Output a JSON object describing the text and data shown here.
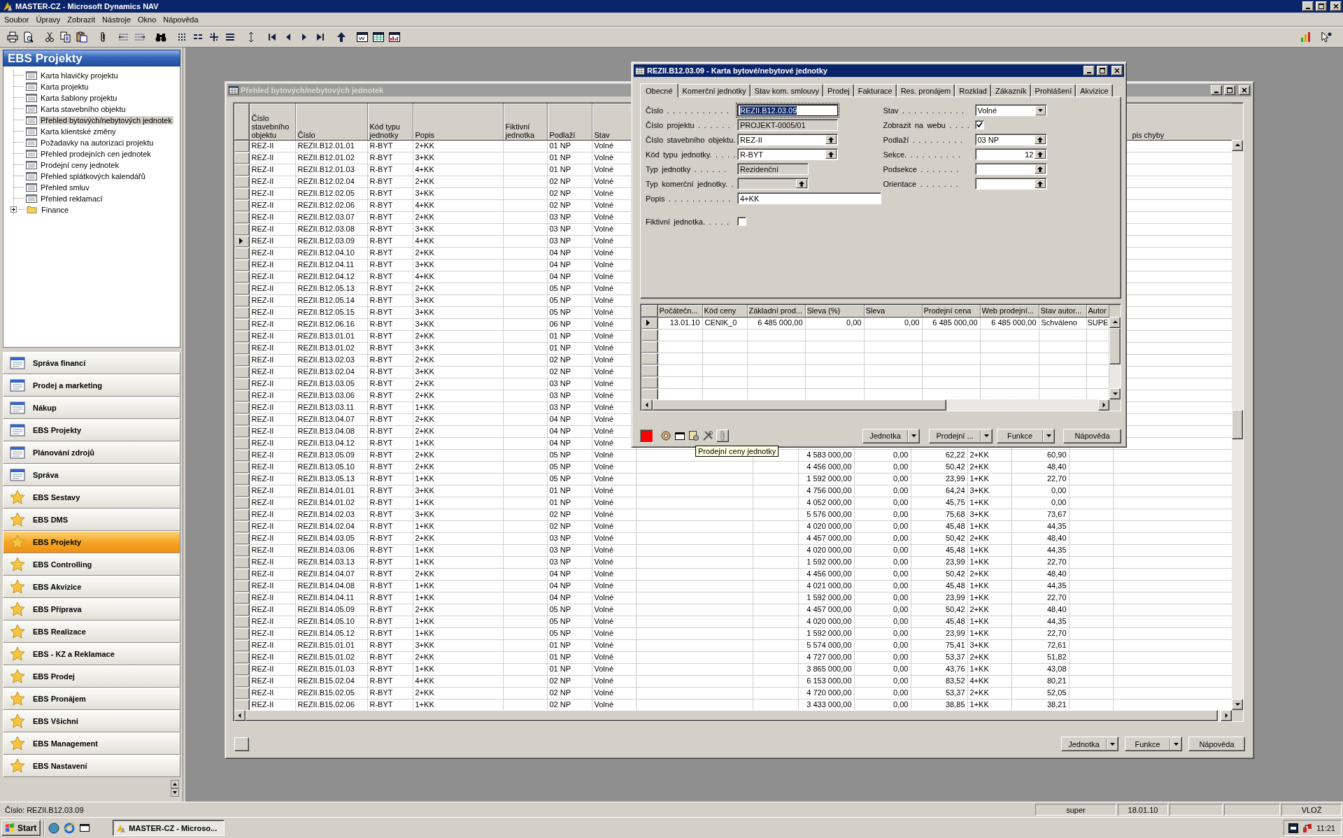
{
  "window": {
    "title": "MASTER-CZ - Microsoft Dynamics NAV"
  },
  "menu": [
    "Soubor",
    "Úpravy",
    "Zobrazit",
    "Nástroje",
    "Okno",
    "Nápověda"
  ],
  "sidebar": {
    "title": "EBS Projekty",
    "items": [
      {
        "label": "Karta hlavičky projektu",
        "kind": "page",
        "selected": false
      },
      {
        "label": "Karta projektu",
        "kind": "page",
        "selected": false
      },
      {
        "label": "Karta šablony projektu",
        "kind": "page",
        "selected": false
      },
      {
        "label": "Karta stavebního objektu",
        "kind": "page",
        "selected": false
      },
      {
        "label": "Přehled bytových/nebytových jednotek",
        "kind": "page",
        "selected": true
      },
      {
        "label": "Karta klientské změny",
        "kind": "page",
        "selected": false
      },
      {
        "label": "Požadavky na autorizaci projektu",
        "kind": "page",
        "selected": false
      },
      {
        "label": "Přehled prodejních cen jednotek",
        "kind": "page",
        "selected": false
      },
      {
        "label": "Prodejní ceny jednotek",
        "kind": "page",
        "selected": false
      },
      {
        "label": "Přehled splátkových kalendářů",
        "kind": "page",
        "selected": false
      },
      {
        "label": "Přehled smluv",
        "kind": "page",
        "selected": false
      },
      {
        "label": "Přehled reklamací",
        "kind": "page",
        "selected": false
      },
      {
        "label": "Finance",
        "kind": "folder",
        "selected": false,
        "expanded": false
      }
    ],
    "modules": [
      {
        "label": "Správa financí",
        "kind": "app",
        "selected": false
      },
      {
        "label": "Prodej a marketing",
        "kind": "app",
        "selected": false
      },
      {
        "label": "Nákup",
        "kind": "app",
        "selected": false
      },
      {
        "label": "EBS Projekty",
        "kind": "app",
        "selected": false
      },
      {
        "label": "Plánování zdrojů",
        "kind": "app",
        "selected": false
      },
      {
        "label": "Správa",
        "kind": "app",
        "selected": false
      },
      {
        "label": "EBS Sestavy",
        "kind": "star",
        "selected": false
      },
      {
        "label": "EBS DMS",
        "kind": "star",
        "selected": false
      },
      {
        "label": "EBS Projekty",
        "kind": "star",
        "selected": true
      },
      {
        "label": "EBS Controlling",
        "kind": "star",
        "selected": false
      },
      {
        "label": "EBS Akvizice",
        "kind": "star",
        "selected": false
      },
      {
        "label": "EBS Příprava",
        "kind": "star",
        "selected": false
      },
      {
        "label": "EBS Realizace",
        "kind": "star",
        "selected": false
      },
      {
        "label": "EBS - KZ a Reklamace",
        "kind": "star",
        "selected": false
      },
      {
        "label": "EBS Prodej",
        "kind": "star",
        "selected": false
      },
      {
        "label": "EBS Pronájem",
        "kind": "star",
        "selected": false
      },
      {
        "label": "EBS Všichni",
        "kind": "star",
        "selected": false
      },
      {
        "label": "EBS Management",
        "kind": "star",
        "selected": false
      },
      {
        "label": "EBS Nastavení",
        "kind": "star",
        "selected": false
      }
    ]
  },
  "list_window": {
    "title": "Přehled bytových/nebytových jednotek",
    "active": false,
    "columns": [
      "Číslo stavebního objektu",
      "Číslo",
      "Kód typu jednotky",
      "Popis",
      "Fiktivní jednotka",
      "Podlaží",
      "Stav",
      "pis chyby"
    ],
    "rows": [
      {
        "objekt": "REZ-II",
        "cislo": "REZII.B12.01.01",
        "typ": "R-BYT",
        "popis": "2+KK",
        "podlazi": "01 NP",
        "stav": "Volné",
        "selected": false
      },
      {
        "objekt": "REZ-II",
        "cislo": "REZII.B12.01.02",
        "typ": "R-BYT",
        "popis": "3+KK",
        "podlazi": "01 NP",
        "stav": "Volné",
        "selected": false
      },
      {
        "objekt": "REZ-II",
        "cislo": "REZII.B12.01.03",
        "typ": "R-BYT",
        "popis": "4+KK",
        "podlazi": "01 NP",
        "stav": "Volné",
        "selected": false
      },
      {
        "objekt": "REZ-II",
        "cislo": "REZII.B12.02.04",
        "typ": "R-BYT",
        "popis": "2+KK",
        "podlazi": "02 NP",
        "stav": "Volné",
        "selected": false
      },
      {
        "objekt": "REZ-II",
        "cislo": "REZII.B12.02.05",
        "typ": "R-BYT",
        "popis": "3+KK",
        "podlazi": "02 NP",
        "stav": "Volné",
        "selected": false
      },
      {
        "objekt": "REZ-II",
        "cislo": "REZII.B12.02.06",
        "typ": "R-BYT",
        "popis": "4+KK",
        "podlazi": "02 NP",
        "stav": "Volné",
        "selected": false
      },
      {
        "objekt": "REZ-II",
        "cislo": "REZII.B12.03.07",
        "typ": "R-BYT",
        "popis": "2+KK",
        "podlazi": "03 NP",
        "stav": "Volné",
        "selected": false
      },
      {
        "objekt": "REZ-II",
        "cislo": "REZII.B12.03.08",
        "typ": "R-BYT",
        "popis": "3+KK",
        "podlazi": "03 NP",
        "stav": "Volné",
        "selected": false
      },
      {
        "objekt": "REZ-II",
        "cislo": "REZII.B12.03.09",
        "typ": "R-BYT",
        "popis": "4+KK",
        "podlazi": "03 NP",
        "stav": "Volné",
        "selected": true
      },
      {
        "objekt": "REZ-II",
        "cislo": "REZII.B12.04.10",
        "typ": "R-BYT",
        "popis": "2+KK",
        "podlazi": "04 NP",
        "stav": "Volné",
        "selected": false
      },
      {
        "objekt": "REZ-II",
        "cislo": "REZII.B12.04.11",
        "typ": "R-BYT",
        "popis": "3+KK",
        "podlazi": "04 NP",
        "stav": "Volné",
        "selected": false
      },
      {
        "objekt": "REZ-II",
        "cislo": "REZII.B12.04.12",
        "typ": "R-BYT",
        "popis": "4+KK",
        "podlazi": "04 NP",
        "stav": "Volné",
        "selected": false
      },
      {
        "objekt": "REZ-II",
        "cislo": "REZII.B12.05.13",
        "typ": "R-BYT",
        "popis": "2+KK",
        "podlazi": "05 NP",
        "stav": "Volné",
        "selected": false
      },
      {
        "objekt": "REZ-II",
        "cislo": "REZII.B12.05.14",
        "typ": "R-BYT",
        "popis": "3+KK",
        "podlazi": "05 NP",
        "stav": "Volné",
        "selected": false
      },
      {
        "objekt": "REZ-II",
        "cislo": "REZII.B12.05.15",
        "typ": "R-BYT",
        "popis": "3+KK",
        "podlazi": "05 NP",
        "stav": "Volné",
        "selected": false
      },
      {
        "objekt": "REZ-II",
        "cislo": "REZII.B12.06.16",
        "typ": "R-BYT",
        "popis": "3+KK",
        "podlazi": "06 NP",
        "stav": "Volné",
        "selected": false
      },
      {
        "objekt": "REZ-II",
        "cislo": "REZII.B13.01.01",
        "typ": "R-BYT",
        "popis": "2+KK",
        "podlazi": "01 NP",
        "stav": "Volné",
        "selected": false
      },
      {
        "objekt": "REZ-II",
        "cislo": "REZII.B13.01.02",
        "typ": "R-BYT",
        "popis": "3+KK",
        "podlazi": "01 NP",
        "stav": "Volné",
        "selected": false
      },
      {
        "objekt": "REZ-II",
        "cislo": "REZII.B13.02.03",
        "typ": "R-BYT",
        "popis": "2+KK",
        "podlazi": "02 NP",
        "stav": "Volné",
        "selected": false
      },
      {
        "objekt": "REZ-II",
        "cislo": "REZII.B13.02.04",
        "typ": "R-BYT",
        "popis": "3+KK",
        "podlazi": "02 NP",
        "stav": "Volné",
        "selected": false
      },
      {
        "objekt": "REZ-II",
        "cislo": "REZII.B13.03.05",
        "typ": "R-BYT",
        "popis": "2+KK",
        "podlazi": "03 NP",
        "stav": "Volné",
        "selected": false
      },
      {
        "objekt": "REZ-II",
        "cislo": "REZII.B13.03.06",
        "typ": "R-BYT",
        "popis": "2+KK",
        "podlazi": "03 NP",
        "stav": "Volné",
        "selected": false
      },
      {
        "objekt": "REZ-II",
        "cislo": "REZII.B13.03.11",
        "typ": "R-BYT",
        "popis": "1+KK",
        "podlazi": "03 NP",
        "stav": "Volné",
        "selected": false
      },
      {
        "objekt": "REZ-II",
        "cislo": "REZII.B13.04.07",
        "typ": "R-BYT",
        "popis": "2+KK",
        "podlazi": "04 NP",
        "stav": "Volné",
        "selected": false
      },
      {
        "objekt": "REZ-II",
        "cislo": "REZII.B13.04.08",
        "typ": "R-BYT",
        "popis": "2+KK",
        "podlazi": "04 NP",
        "stav": "Volné",
        "selected": false
      },
      {
        "objekt": "REZ-II",
        "cislo": "REZII.B13.04.12",
        "typ": "R-BYT",
        "popis": "1+KK",
        "podlazi": "04 NP",
        "stav": "Volné",
        "selected": false
      },
      {
        "objekt": "REZ-II",
        "cislo": "REZII.B13.05.09",
        "typ": "R-BYT",
        "popis": "2+KK",
        "podlazi": "05 NP",
        "stav": "Volné",
        "column_10": "4 583 000,00",
        "column_11": "0,00",
        "column_12": "62,22",
        "column_13": "2+KK",
        "column_14": "60,90",
        "selected": false
      },
      {
        "objekt": "REZ-II",
        "cislo": "REZII.B13.05.10",
        "typ": "R-BYT",
        "popis": "2+KK",
        "podlazi": "05 NP",
        "stav": "Volné",
        "column_10": "4 456 000,00",
        "column_11": "0,00",
        "column_12": "50,42",
        "column_13": "2+KK",
        "column_14": "48,40",
        "selected": false
      },
      {
        "objekt": "REZ-II",
        "cislo": "REZII.B13.05.13",
        "typ": "R-BYT",
        "popis": "1+KK",
        "podlazi": "05 NP",
        "stav": "Volné",
        "column_10": "1 592 000,00",
        "column_11": "0,00",
        "column_12": "23,99",
        "column_13": "1+KK",
        "column_14": "22,70",
        "selected": false
      },
      {
        "objekt": "REZ-II",
        "cislo": "REZII.B14.01.01",
        "typ": "R-BYT",
        "popis": "3+KK",
        "podlazi": "01 NP",
        "stav": "Volné",
        "column_10": "4 756 000,00",
        "column_11": "0,00",
        "column_12": "64,24",
        "column_13": "3+KK",
        "column_14": "0,00",
        "selected": false
      },
      {
        "objekt": "REZ-II",
        "cislo": "REZII.B14.01.02",
        "typ": "R-BYT",
        "popis": "1+KK",
        "podlazi": "01 NP",
        "stav": "Volné",
        "column_10": "4 052 000,00",
        "column_11": "0,00",
        "column_12": "45,75",
        "column_13": "1+KK",
        "column_14": "0,00",
        "selected": false
      },
      {
        "objekt": "REZ-II",
        "cislo": "REZII.B14.02.03",
        "typ": "R-BYT",
        "popis": "3+KK",
        "podlazi": "02 NP",
        "stav": "Volné",
        "column_10": "5 576 000,00",
        "column_11": "0,00",
        "column_12": "75,68",
        "column_13": "3+KK",
        "column_14": "73,67",
        "selected": false
      },
      {
        "objekt": "REZ-II",
        "cislo": "REZII.B14.02.04",
        "typ": "R-BYT",
        "popis": "1+KK",
        "podlazi": "02 NP",
        "stav": "Volné",
        "column_10": "4 020 000,00",
        "column_11": "0,00",
        "column_12": "45,48",
        "column_13": "1+KK",
        "column_14": "44,35",
        "selected": false
      },
      {
        "objekt": "REZ-II",
        "cislo": "REZII.B14.03.05",
        "typ": "R-BYT",
        "popis": "2+KK",
        "podlazi": "03 NP",
        "stav": "Volné",
        "column_10": "4 457 000,00",
        "column_11": "0,00",
        "column_12": "50,42",
        "column_13": "2+KK",
        "column_14": "48,40",
        "selected": false
      },
      {
        "objekt": "REZ-II",
        "cislo": "REZII.B14.03.06",
        "typ": "R-BYT",
        "popis": "1+KK",
        "podlazi": "03 NP",
        "stav": "Volné",
        "column_10": "4 020 000,00",
        "column_11": "0,00",
        "column_12": "45,48",
        "column_13": "1+KK",
        "column_14": "44,35",
        "selected": false
      },
      {
        "objekt": "REZ-II",
        "cislo": "REZII.B14.03.13",
        "typ": "R-BYT",
        "popis": "1+KK",
        "podlazi": "03 NP",
        "stav": "Volné",
        "column_10": "1 592 000,00",
        "column_11": "0,00",
        "column_12": "23,99",
        "column_13": "1+KK",
        "column_14": "22,70",
        "selected": false
      },
      {
        "objekt": "REZ-II",
        "cislo": "REZII.B14.04.07",
        "typ": "R-BYT",
        "popis": "2+KK",
        "podlazi": "04 NP",
        "stav": "Volné",
        "column_10": "4 456 000,00",
        "column_11": "0,00",
        "column_12": "50,42",
        "column_13": "2+KK",
        "column_14": "48,40",
        "selected": false
      },
      {
        "objekt": "REZ-II",
        "cislo": "REZII.B14.04.08",
        "typ": "R-BYT",
        "popis": "1+KK",
        "podlazi": "04 NP",
        "stav": "Volné",
        "column_10": "4 021 000,00",
        "column_11": "0,00",
        "column_12": "45,48",
        "column_13": "1+KK",
        "column_14": "44,35",
        "selected": false
      },
      {
        "objekt": "REZ-II",
        "cislo": "REZII.B14.04.11",
        "typ": "R-BYT",
        "popis": "1+KK",
        "podlazi": "04 NP",
        "stav": "Volné",
        "column_10": "1 592 000,00",
        "column_11": "0,00",
        "column_12": "23,99",
        "column_13": "1+KK",
        "column_14": "22,70",
        "selected": false
      },
      {
        "objekt": "REZ-II",
        "cislo": "REZII.B14.05.09",
        "typ": "R-BYT",
        "popis": "2+KK",
        "podlazi": "05 NP",
        "stav": "Volné",
        "column_10": "4 457 000,00",
        "column_11": "0,00",
        "column_12": "50,42",
        "column_13": "2+KK",
        "column_14": "48,40",
        "selected": false
      },
      {
        "objekt": "REZ-II",
        "cislo": "REZII.B14.05.10",
        "typ": "R-BYT",
        "popis": "1+KK",
        "podlazi": "05 NP",
        "stav": "Volné",
        "column_10": "4 020 000,00",
        "column_11": "0,00",
        "column_12": "45,48",
        "column_13": "1+KK",
        "column_14": "44,35",
        "selected": false
      },
      {
        "objekt": "REZ-II",
        "cislo": "REZII.B14.05.12",
        "typ": "R-BYT",
        "popis": "1+KK",
        "podlazi": "05 NP",
        "stav": "Volné",
        "column_10": "1 592 000,00",
        "column_11": "0,00",
        "column_12": "23,99",
        "column_13": "1+KK",
        "column_14": "22,70",
        "selected": false
      },
      {
        "objekt": "REZ-II",
        "cislo": "REZII.B15.01.01",
        "typ": "R-BYT",
        "popis": "3+KK",
        "podlazi": "01 NP",
        "stav": "Volné",
        "column_10": "5 574 000,00",
        "column_11": "0,00",
        "column_12": "75,41",
        "column_13": "3+KK",
        "column_14": "72,61",
        "selected": false
      },
      {
        "objekt": "REZ-II",
        "cislo": "REZII.B15.01.02",
        "typ": "R-BYT",
        "popis": "2+KK",
        "podlazi": "01 NP",
        "stav": "Volné",
        "column_10": "4 727 000,00",
        "column_11": "0,00",
        "column_12": "53,37",
        "column_13": "2+KK",
        "column_14": "51,82",
        "selected": false
      },
      {
        "objekt": "REZ-II",
        "cislo": "REZII.B15.01.03",
        "typ": "R-BYT",
        "popis": "1+KK",
        "podlazi": "01 NP",
        "stav": "Volné",
        "column_10": "3 865 000,00",
        "column_11": "0,00",
        "column_12": "43,76",
        "column_13": "1+KK",
        "column_14": "43,08",
        "selected": false
      },
      {
        "objekt": "REZ-II",
        "cislo": "REZII.B15.02.04",
        "typ": "R-BYT",
        "popis": "4+KK",
        "podlazi": "02 NP",
        "stav": "Volné",
        "column_10": "6 153 000,00",
        "column_11": "0,00",
        "column_12": "83,52",
        "column_13": "4+KK",
        "column_14": "80,21",
        "selected": false
      },
      {
        "objekt": "REZ-II",
        "cislo": "REZII.B15.02.05",
        "typ": "R-BYT",
        "popis": "2+KK",
        "podlazi": "02 NP",
        "stav": "Volné",
        "column_10": "4 720 000,00",
        "column_11": "0,00",
        "column_12": "53,37",
        "column_13": "2+KK",
        "column_14": "52,05",
        "selected": false
      },
      {
        "objekt": "REZ-II",
        "cislo": "REZII.B15.02.06",
        "typ": "R-BYT",
        "popis": "1+KK",
        "podlazi": "02 NP",
        "stav": "Volné",
        "column_10": "3 433 000,00",
        "column_11": "0,00",
        "column_12": "38,85",
        "column_13": "1+KK",
        "column_14": "38,21",
        "selected": false
      }
    ],
    "buttons": [
      {
        "label": "Jednotka",
        "kind": "menu"
      },
      {
        "label": "Funkce",
        "kind": "menu"
      },
      {
        "label": "Nápověda",
        "kind": "help"
      }
    ]
  },
  "card_window": {
    "title": "REZII.B12.03.09 - Karta bytové/nebytové jednotky",
    "active": true,
    "tabs": [
      {
        "label": "Obecné",
        "selected": true
      },
      {
        "label": "Komerční jednotky",
        "selected": false
      },
      {
        "label": "Stav kom. smlouvy",
        "selected": false
      },
      {
        "label": "Prodej",
        "selected": false
      },
      {
        "label": "Fakturace",
        "selected": false
      },
      {
        "label": "Res. pronájem",
        "selected": false
      },
      {
        "label": "Rozklad",
        "selected": false
      },
      {
        "label": "Zákazník",
        "selected": false
      },
      {
        "label": "Prohlášení",
        "selected": false
      },
      {
        "label": "Akvizice",
        "selected": false
      }
    ],
    "fields_left": [
      {
        "label": "Číslo . . . . . . . . . . .",
        "kind": "text",
        "value": "REZII.B12.03.09",
        "focused": true
      },
      {
        "label": "Číslo projektu . . . . . .",
        "kind": "readonly",
        "value": "PROJEKT-0005/01",
        "focused": false
      },
      {
        "label": "Číslo stavebního objektu.",
        "kind": "lookup",
        "value": "REZ-II",
        "focused": false
      },
      {
        "label": "Kód typu jednotky. . . . .",
        "kind": "lookup",
        "value": "R-BYT",
        "focused": false
      },
      {
        "label": "Typ jednotky . . . . . .",
        "kind": "readonly",
        "value": "Rezidenční",
        "focused": false
      },
      {
        "label": "Typ komerční jednotky. .",
        "kind": "readonly_lookup",
        "focused": false
      },
      {
        "label": "Popis . . . . . . . . . . .",
        "kind": "text",
        "value": "4+KK",
        "focused": false
      },
      {
        "label": "Fiktivní jednotka. . . . .",
        "kind": "checkbox",
        "checked": false
      }
    ],
    "fields_right": [
      {
        "label": "Stav . . . . . . . . . . .",
        "kind": "dropdown",
        "value": "Volné",
        "focused": false
      },
      {
        "label": "Zobrazit na webu . . . .",
        "kind": "checkbox",
        "checked": true
      },
      {
        "label": "Podlaží . . . . . . . . .",
        "kind": "lookup",
        "value": "03 NP",
        "focused": false
      },
      {
        "label": "Sekce. . . . . . . . . .",
        "kind": "number_lookup",
        "value": "12",
        "focused": false
      },
      {
        "label": "Podsekce . . . . . . .",
        "kind": "lookup",
        "focused": false
      },
      {
        "label": "Orientace . . . . . . .",
        "kind": "lookup",
        "focused": false
      }
    ],
    "lines": {
      "columns": [
        "Počátečn...",
        "Kód ceny",
        "Základní prod...",
        "Sleva (%)",
        "Sleva",
        "Prodejní cena",
        "Web prodejní...",
        "Stav autor...",
        "Autor"
      ],
      "rows": [
        {
          "selected": true,
          "cells": [
            "13.01.10",
            "CENIK_0",
            "6 485 000,00",
            "0,00",
            "0,00",
            "6 485 000,00",
            "6 485 000,00",
            "Schváleno",
            "SUPE"
          ]
        }
      ]
    },
    "buttons": [
      {
        "label": "Jednotka",
        "kind": "menu"
      },
      {
        "label": "Prodejní ...",
        "kind": "menu"
      },
      {
        "label": "Funkce",
        "kind": "menu"
      },
      {
        "label": "Nápověda",
        "kind": "help"
      }
    ]
  },
  "tooltip": "Prodejní ceny jednotky",
  "status_bar": {
    "message": "Číslo: REZII.B12.03.09",
    "user": "super",
    "date": "18.01.10",
    "mode": "VLOŽ"
  },
  "taskbar": {
    "start": "Start",
    "tasks": [
      {
        "label": "MASTER-CZ - Microso...",
        "selected": true
      }
    ],
    "clock": "11:21"
  }
}
